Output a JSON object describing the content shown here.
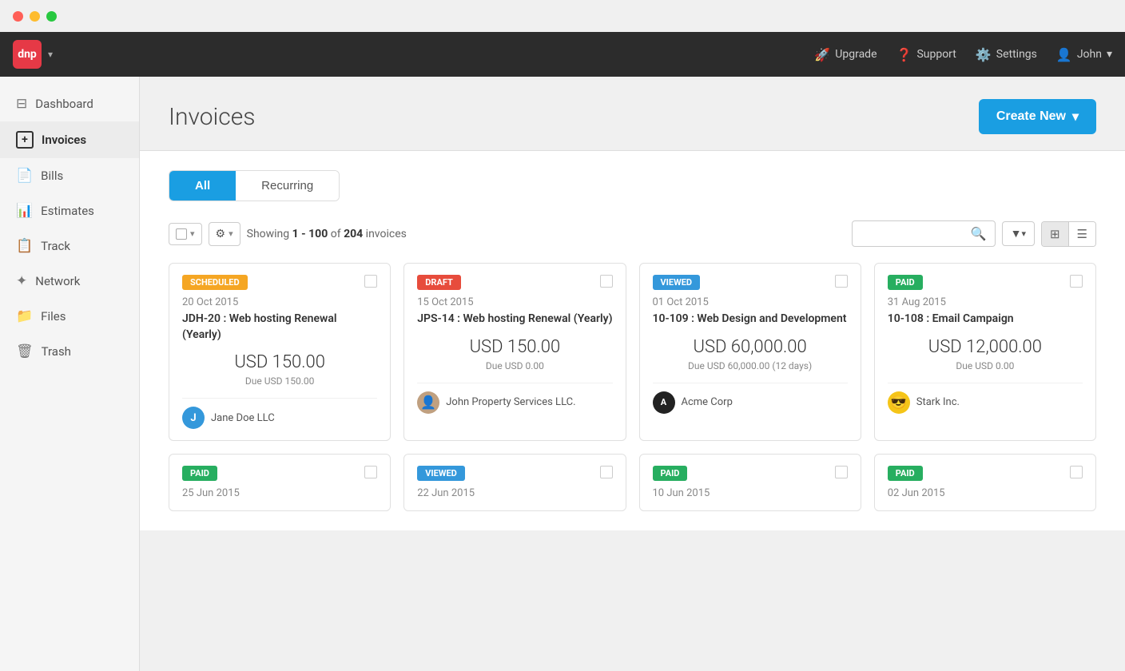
{
  "titlebar": {
    "close": "close",
    "min": "minimize",
    "max": "maximize"
  },
  "topnav": {
    "logo_text": "dnp",
    "chevron": "▾",
    "upgrade_label": "Upgrade",
    "support_label": "Support",
    "settings_label": "Settings",
    "user_label": "John",
    "user_chevron": "▾"
  },
  "sidebar": {
    "items": [
      {
        "id": "dashboard",
        "label": "Dashboard",
        "icon": "⊟"
      },
      {
        "id": "invoices",
        "label": "Invoices",
        "icon": "＋"
      },
      {
        "id": "bills",
        "label": "Bills",
        "icon": "📄"
      },
      {
        "id": "estimates",
        "label": "Estimates",
        "icon": "📊"
      },
      {
        "id": "track",
        "label": "Track",
        "icon": "📋"
      },
      {
        "id": "network",
        "label": "Network",
        "icon": "✦"
      },
      {
        "id": "files",
        "label": "Files",
        "icon": "📁"
      },
      {
        "id": "trash",
        "label": "Trash",
        "icon": "🗑"
      }
    ]
  },
  "page": {
    "title": "Invoices",
    "create_new_label": "Create New",
    "create_new_chevron": "▾"
  },
  "tabs": [
    {
      "id": "all",
      "label": "All",
      "active": true
    },
    {
      "id": "recurring",
      "label": "Recurring",
      "active": false
    }
  ],
  "toolbar": {
    "showing_text": "Showing",
    "range": "1 - 100",
    "of_text": "of",
    "total": "204",
    "invoices_text": "invoices",
    "search_placeholder": "",
    "view_grid": "⊞",
    "view_list": "☰"
  },
  "invoices": [
    {
      "status": "SCHEDULED",
      "status_class": "badge-scheduled",
      "date": "20 Oct 2015",
      "title": "JDH-20 : Web hosting Renewal (Yearly)",
      "amount": "USD 150.00",
      "due": "Due USD 150.00",
      "client": "Jane Doe LLC",
      "avatar_type": "initial",
      "avatar_initial": "J",
      "avatar_color": "#3498db"
    },
    {
      "status": "DRAFT",
      "status_class": "badge-draft",
      "date": "15 Oct 2015",
      "title": "JPS-14 : Web hosting Renewal (Yearly)",
      "amount": "USD 150.00",
      "due": "Due USD 0.00",
      "client": "John Property Services LLC.",
      "avatar_type": "image",
      "avatar_initial": "J",
      "avatar_color": "#aaa"
    },
    {
      "status": "VIEWED",
      "status_class": "badge-viewed",
      "date": "01 Oct 2015",
      "title": "10-109 : Web Design and Development",
      "amount": "USD 60,000.00",
      "due": "Due USD 60,000.00 (12 days)",
      "client": "Acme Corp",
      "avatar_type": "dark",
      "avatar_initial": "A",
      "avatar_color": "#333"
    },
    {
      "status": "PAID",
      "status_class": "badge-paid",
      "date": "31 Aug 2015",
      "title": "10-108 : Email Campaign",
      "amount": "USD 12,000.00",
      "due": "Due USD 0.00",
      "client": "Stark Inc.",
      "avatar_type": "emoji",
      "avatar_initial": "😎",
      "avatar_color": "#f5c518"
    }
  ],
  "bottom_invoices": [
    {
      "status": "PAID",
      "status_class": "badge-paid",
      "date": "25 Jun 2015"
    },
    {
      "status": "VIEWED",
      "status_class": "badge-viewed",
      "date": "22 Jun 2015"
    },
    {
      "status": "PAID",
      "status_class": "badge-paid",
      "date": "10 Jun 2015"
    },
    {
      "status": "PAID",
      "status_class": "badge-paid",
      "date": "02 Jun 2015"
    }
  ]
}
